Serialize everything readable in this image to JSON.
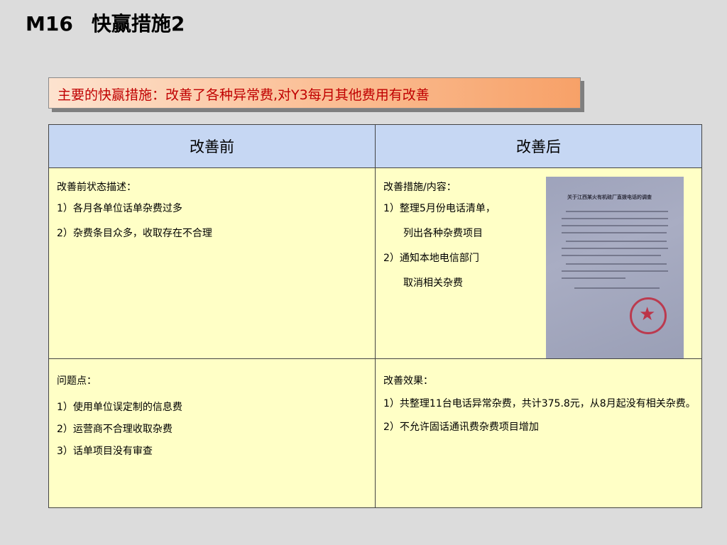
{
  "title": {
    "code": "M16",
    "text": "快赢措施2"
  },
  "banner": {
    "text": "主要的快赢措施：改善了各种异常费,对Y3每月其他费用有改善"
  },
  "table": {
    "header_before": "改善前",
    "header_after": "改善后",
    "before_status": {
      "heading": "改善前状态描述：",
      "items": [
        "1）各月各单位话单杂费过多",
        "2）杂费条目众多，收取存在不合理"
      ]
    },
    "measures": {
      "heading": "改善措施/内容：",
      "items": [
        "1）整理5月份电话清单，",
        "列出各种杂费项目",
        "2）通知本地电信部门",
        "取消相关杂费"
      ]
    },
    "problems": {
      "heading": "问题点：",
      "items": [
        "1）使用单位误定制的信息费",
        "2）运营商不合理收取杂费",
        "3）话单项目没有审查"
      ]
    },
    "effects": {
      "heading": "改善效果：",
      "items": [
        "1）共整理11台电话异常杂费，共计375.8元，从8月起没有相关杂费。",
        "2）不允许固话通讯费杂费项目增加"
      ]
    }
  },
  "photo": {
    "doc_title": "关于江西某火有机硅厂直拨电话的调查"
  },
  "colors": {
    "background": "#dcdcdc",
    "banner_text": "#c00000",
    "header_bg": "#c6d7f3",
    "cell_bg": "#ffffc6"
  }
}
